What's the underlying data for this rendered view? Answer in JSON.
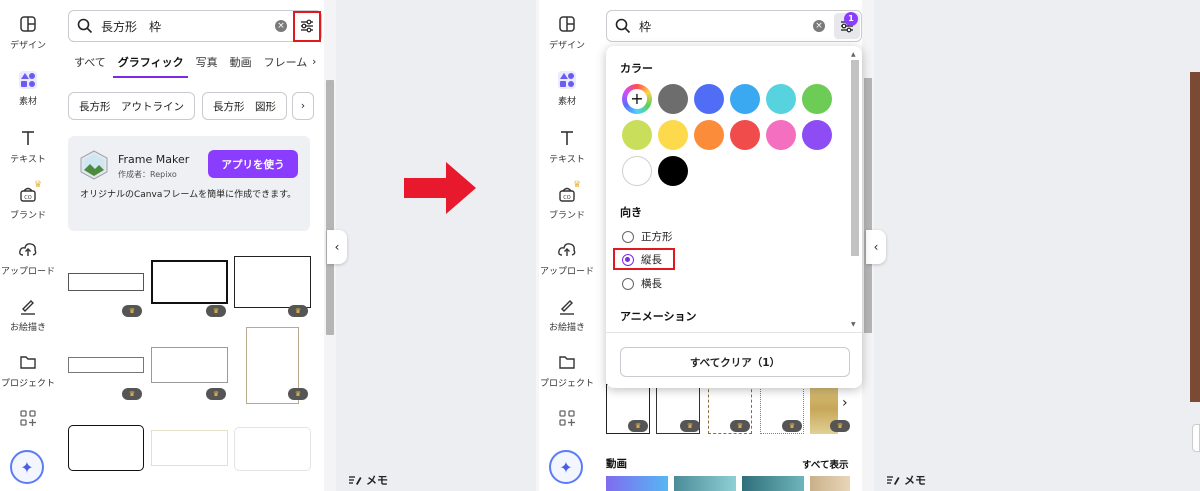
{
  "left_rail": {
    "items": [
      {
        "label": "デザイン",
        "icon": "design-icon"
      },
      {
        "label": "素材",
        "icon": "elements-icon"
      },
      {
        "label": "テキスト",
        "icon": "text-icon"
      },
      {
        "label": "ブランド",
        "icon": "brand-icon"
      },
      {
        "label": "アップロード",
        "icon": "upload-icon"
      },
      {
        "label": "お絵描き",
        "icon": "draw-icon"
      },
      {
        "label": "プロジェクト",
        "icon": "folder-icon"
      }
    ]
  },
  "left_panel": {
    "search_value": "長方形　枠",
    "tabs": [
      "すべて",
      "グラフィック",
      "写真",
      "動画",
      "フレーム"
    ],
    "chips": [
      "長方形　アウトライン",
      "長方形　図形"
    ],
    "promo": {
      "name": "Frame Maker",
      "by": "作成者：Repixo",
      "button": "アプリを使う",
      "description": "オリジナルのCanvaフレームを簡単に作成できます。"
    }
  },
  "memo_label": "メモ",
  "right_panel": {
    "search_value": "枠",
    "filter_count": "1",
    "popover": {
      "color_heading": "カラー",
      "colors": [
        "#6d6d6d",
        "#4f6ef5",
        "#3ba8f2",
        "#56d3df",
        "#6ccc55",
        "#c9de5a",
        "#fdd94c",
        "#fb8c3a",
        "#f04c4c",
        "#f56fc0",
        "#8e4cf5",
        "#ffffff",
        "#000000"
      ],
      "orientation_heading": "向き",
      "orientation_options": [
        {
          "label": "正方形",
          "selected": false
        },
        {
          "label": "縦長",
          "selected": true
        },
        {
          "label": "横長",
          "selected": false
        }
      ],
      "animation_heading": "アニメーション",
      "clear_all": "すべてクリア（1）"
    },
    "video_heading": "動画",
    "see_all": "すべて表示"
  },
  "accent_colors": {
    "purple": "#8b3dff",
    "highlight_red": "#e0191f"
  }
}
